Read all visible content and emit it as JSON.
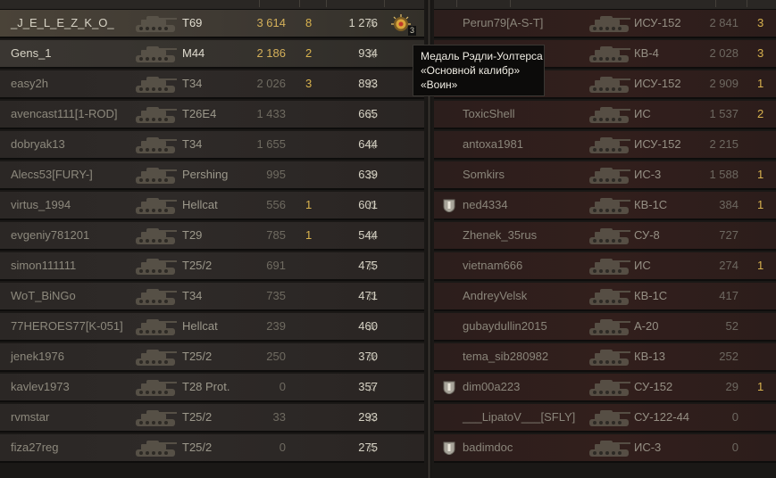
{
  "left_team": {
    "rows": [
      {
        "player": "_J_E_L_E_Z_K_O_",
        "vehicle": "T69",
        "damage": "3 614",
        "kills": "8",
        "xp": "1 276",
        "style": "hl"
      },
      {
        "player": "Gens_1",
        "vehicle": "M44",
        "damage": "2 186",
        "kills": "2",
        "xp": "934",
        "style": "hl2"
      },
      {
        "player": "easy2h",
        "vehicle": "T34",
        "damage": "2 026",
        "kills": "3",
        "xp": "893",
        "style": ""
      },
      {
        "player": "avencast111[1-ROD]",
        "vehicle": "T26E4",
        "damage": "1 433",
        "kills": "",
        "xp": "665",
        "style": ""
      },
      {
        "player": "dobryak13",
        "vehicle": "T34",
        "damage": "1 655",
        "kills": "",
        "xp": "644",
        "style": ""
      },
      {
        "player": "Alecs53[FURY-]",
        "vehicle": "Pershing",
        "damage": "995",
        "kills": "",
        "xp": "639",
        "style": ""
      },
      {
        "player": "virtus_1994",
        "vehicle": "Hellcat",
        "damage": "556",
        "kills": "1",
        "xp": "601",
        "style": ""
      },
      {
        "player": "evgeniy781201",
        "vehicle": "T29",
        "damage": "785",
        "kills": "1",
        "xp": "544",
        "style": ""
      },
      {
        "player": "simon111111",
        "vehicle": "T25/2",
        "damage": "691",
        "kills": "",
        "xp": "475",
        "style": ""
      },
      {
        "player": "WoT_BiNGo",
        "vehicle": "T34",
        "damage": "735",
        "kills": "",
        "xp": "471",
        "style": ""
      },
      {
        "player": "77HEROES77[K-051]",
        "vehicle": "Hellcat",
        "damage": "239",
        "kills": "",
        "xp": "460",
        "style": ""
      },
      {
        "player": "jenek1976",
        "vehicle": "T25/2",
        "damage": "250",
        "kills": "",
        "xp": "370",
        "style": ""
      },
      {
        "player": "kavlev1973",
        "vehicle": "T28 Prot.",
        "damage": "0",
        "kills": "",
        "xp": "357",
        "style": ""
      },
      {
        "player": "rvmstar",
        "vehicle": "T25/2",
        "damage": "33",
        "kills": "",
        "xp": "293",
        "style": ""
      },
      {
        "player": "fiza27reg",
        "vehicle": "T25/2",
        "damage": "0",
        "kills": "",
        "xp": "275",
        "style": ""
      }
    ],
    "star_glyph": "☆",
    "medal_count": "3"
  },
  "right_team": {
    "rows": [
      {
        "player": "Perun79[A-S-T]",
        "vehicle": "ИСУ-152",
        "damage": "2 841",
        "kills": "3",
        "icon": false
      },
      {
        "player": "",
        "vehicle": "КВ-4",
        "damage": "2 028",
        "kills": "3",
        "icon": false
      },
      {
        "player": "",
        "vehicle": "ИСУ-152",
        "damage": "2 909",
        "kills": "1",
        "icon": false
      },
      {
        "player": "ToxicShell",
        "vehicle": "ИС",
        "damage": "1 537",
        "kills": "2",
        "icon": false
      },
      {
        "player": "antoxa1981",
        "vehicle": "ИСУ-152",
        "damage": "2 215",
        "kills": "",
        "icon": false
      },
      {
        "player": "Somkirs",
        "vehicle": "ИС-3",
        "damage": "1 588",
        "kills": "1",
        "icon": false
      },
      {
        "player": "ned4334",
        "vehicle": "КВ-1С",
        "damage": "384",
        "kills": "1",
        "icon": true
      },
      {
        "player": "Zhenek_35rus",
        "vehicle": "СУ-8",
        "damage": "727",
        "kills": "",
        "icon": false
      },
      {
        "player": "vietnam666",
        "vehicle": "ИС",
        "damage": "274",
        "kills": "1",
        "icon": false
      },
      {
        "player": "AndreyVelsk",
        "vehicle": "КВ-1С",
        "damage": "417",
        "kills": "",
        "icon": false
      },
      {
        "player": "gubaydullin2015",
        "vehicle": "А-20",
        "damage": "52",
        "kills": "",
        "icon": false
      },
      {
        "player": "tema_sib280982",
        "vehicle": "КВ-13",
        "damage": "252",
        "kills": "",
        "icon": false
      },
      {
        "player": "dim00a223",
        "vehicle": "СУ-152",
        "damage": "29",
        "kills": "1",
        "icon": true
      },
      {
        "player": "___LipatoV___[SFLY]",
        "vehicle": "СУ-122-44",
        "damage": "0",
        "kills": "",
        "icon": false
      },
      {
        "player": "badimdoc",
        "vehicle": "ИС-3",
        "damage": "0",
        "kills": "",
        "icon": true
      }
    ]
  },
  "tooltip": {
    "lines": [
      "Медаль Рэдли-Уолтерса",
      "«Основной калибр»",
      "«Воин»"
    ]
  },
  "colors": {
    "gold": "#d8b24e",
    "highlight_row": "#4a4338",
    "enemy_row": "#321f1c"
  }
}
